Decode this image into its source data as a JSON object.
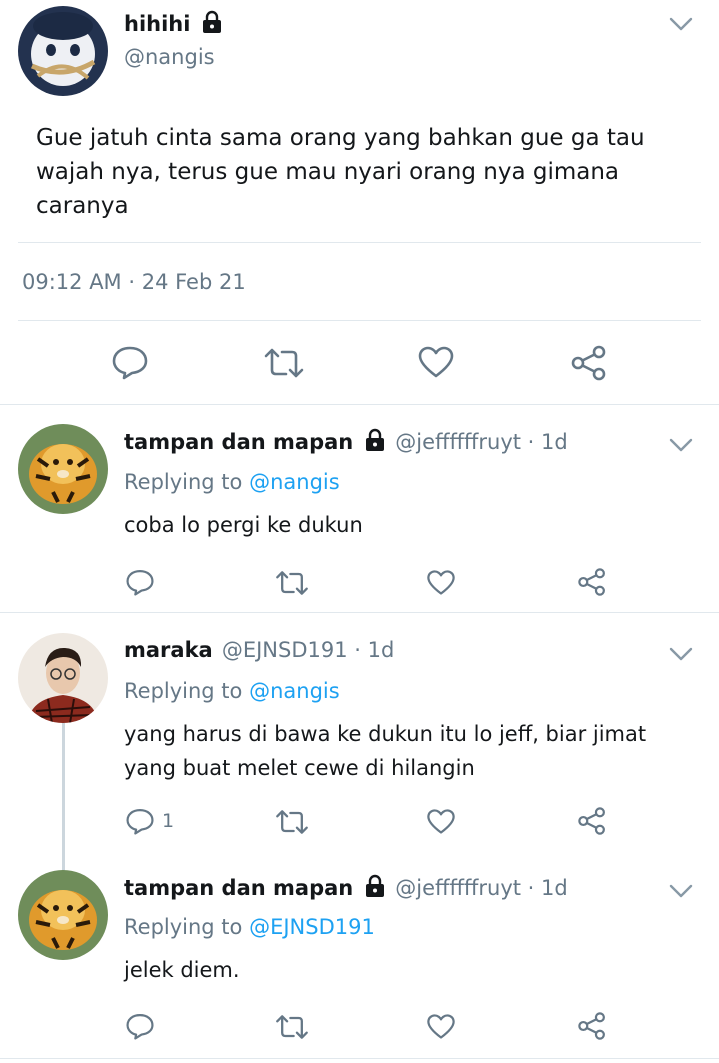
{
  "main_tweet": {
    "name": "hihihi",
    "handle": "@nangis",
    "text": "Gue jatuh cinta sama orang yang bahkan gue ga tau wajah nya, terus gue mau nyari orang nya gimana caranya",
    "timestamp": "09:12 AM · 24 Feb 21"
  },
  "replies": [
    {
      "name": "tampan dan mapan",
      "handle": "@jeffffffruyt · 1d",
      "replying_label": "Replying to",
      "replying_to": "@nangis",
      "text": "coba lo pergi ke dukun",
      "reply_count": ""
    },
    {
      "name": "maraka",
      "handle": "@EJNSD191 · 1d",
      "replying_label": "Replying to",
      "replying_to": "@nangis",
      "text": "yang harus di bawa ke dukun itu lo jeff, biar jimat yang buat melet cewe di hilangin",
      "reply_count": "1"
    },
    {
      "name": "tampan dan mapan",
      "handle": "@jeffffffruyt · 1d",
      "replying_label": "Replying to",
      "replying_to": "@EJNSD191",
      "text": "jelek diem.",
      "reply_count": ""
    }
  ],
  "icons": [
    "lock-icon",
    "chevron-down-icon",
    "reply-icon",
    "retweet-icon",
    "like-icon",
    "share-icon"
  ],
  "colors": {
    "link": "#1da1f2",
    "secondary": "#657786",
    "divider": "#e1e8ed",
    "icon": "#657786"
  }
}
